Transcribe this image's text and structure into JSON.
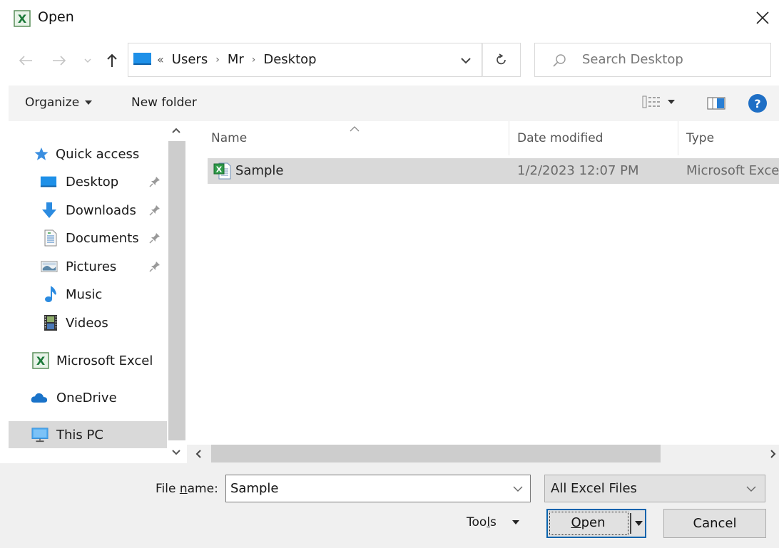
{
  "window": {
    "title": "Open",
    "close_label": "Close"
  },
  "nav": {
    "back_label": "Back",
    "forward_label": "Forward",
    "up_label": "Up",
    "breadcrumb": {
      "overflow": "«",
      "items": [
        "Users",
        "Mr",
        "Desktop"
      ],
      "separator": "›"
    },
    "refresh_label": "Refresh",
    "search_placeholder": "Search Desktop",
    "search_value": ""
  },
  "commandbar": {
    "organize_label": "Organize",
    "new_folder_label": "New folder"
  },
  "sidebar": {
    "items": [
      {
        "label": "Quick access",
        "icon": "star-icon",
        "pinned": false
      },
      {
        "label": "Desktop",
        "icon": "desktop-icon",
        "pinned": true
      },
      {
        "label": "Downloads",
        "icon": "download-arrow-icon",
        "pinned": true
      },
      {
        "label": "Documents",
        "icon": "document-icon",
        "pinned": true
      },
      {
        "label": "Pictures",
        "icon": "pictures-icon",
        "pinned": true
      },
      {
        "label": "Music",
        "icon": "music-note-icon",
        "pinned": false
      },
      {
        "label": "Videos",
        "icon": "film-icon",
        "pinned": false
      },
      {
        "label": "Microsoft Excel",
        "icon": "excel-icon",
        "pinned": false
      },
      {
        "label": "OneDrive",
        "icon": "cloud-icon",
        "pinned": false
      },
      {
        "label": "This PC",
        "icon": "monitor-icon",
        "pinned": false,
        "selected": true
      }
    ]
  },
  "filelist": {
    "columns": [
      "Name",
      "Date modified",
      "Type"
    ],
    "sort_column": "Name",
    "rows": [
      {
        "name": "Sample",
        "date_modified": "1/2/2023 12:07 PM",
        "type": "Microsoft Excel",
        "selected": true
      }
    ]
  },
  "footer": {
    "file_name_label_pre": "File ",
    "file_name_label_accel": "n",
    "file_name_label_post": "ame:",
    "file_name_value": "Sample",
    "file_type_selected": "All Excel Files",
    "tools_pre": "Too",
    "tools_accel": "l",
    "tools_post": "s",
    "open_accel": "O",
    "open_rest": "pen",
    "cancel_label": "Cancel"
  },
  "colors": {
    "accent_blue": "#0a64ad",
    "selection_gray": "#d9d9d9",
    "help_blue": "#1f6fc5",
    "excel_green": "#1d7a3a"
  }
}
